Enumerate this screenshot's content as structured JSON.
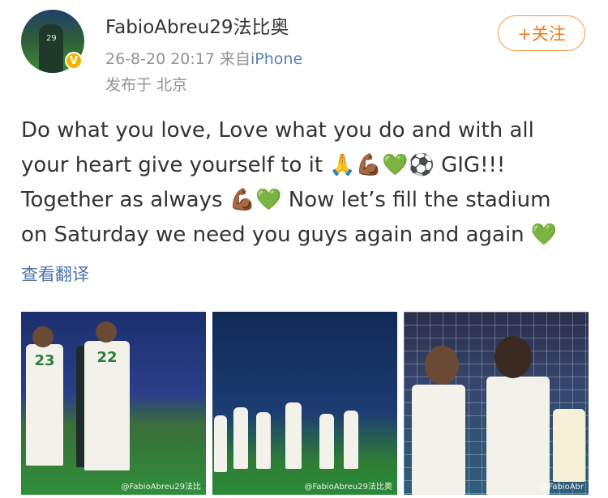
{
  "post": {
    "author": "FabioAbreu29法比奥",
    "time": "26-8-20 20:17",
    "source_prefix": "来自",
    "source": "iPhone",
    "location": "发布于 北京",
    "follow_label": "+关注",
    "text": "Do what you love, Love what you do and with all\nyour heart give yourself to it 🙏💪🏾💚⚽ GIG!!!\nTogether as always 💪🏾💚 Now let’s fill the stadium\non Saturday we need you guys again and again 💚",
    "translate_label": "查看翻译"
  },
  "avatar": {
    "jersey_number": "29",
    "badge_icon": "verified-v"
  },
  "photos": [
    {
      "jersey_numbers": [
        "23",
        "22"
      ],
      "watermark": "@FabioAbreu29法比"
    },
    {
      "watermark": "@FabioAbreu29法比奥"
    },
    {
      "watermark": "@FabioAbr"
    }
  ],
  "colors": {
    "follow_accent": "#f0791e",
    "link": "#4d72a8",
    "source_link": "#5b7fb8",
    "verified": "#f5b400"
  }
}
